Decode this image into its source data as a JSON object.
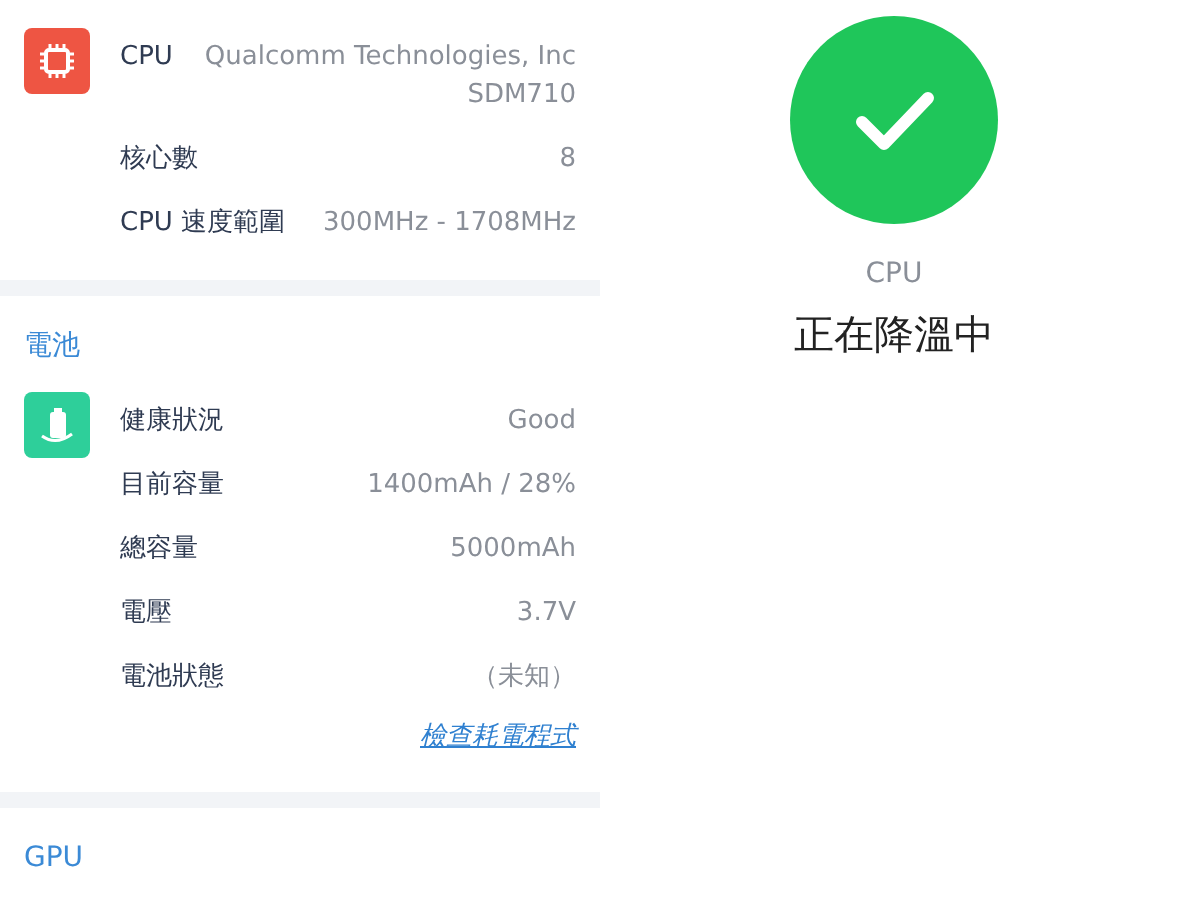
{
  "sections": [
    {
      "kind": "chip",
      "rows": [
        {
          "label": "CPU",
          "value": "Qualcomm Technologies, Inc\nSDM710"
        },
        {
          "label": "核心數",
          "value": "8"
        },
        {
          "label": "CPU 速度範圍",
          "value": "300MHz - 1708MHz"
        }
      ]
    },
    {
      "kind": "battery",
      "title": "電池",
      "rows": [
        {
          "label": "健康狀況",
          "value": "Good"
        },
        {
          "label": "目前容量",
          "value": "1400mAh / 28%"
        },
        {
          "label": "總容量",
          "value": "5000mAh"
        },
        {
          "label": "電壓",
          "value": "3.7V"
        },
        {
          "label": "電池狀態",
          "value": "（未知）"
        }
      ],
      "link": "檢查耗電程式"
    },
    {
      "title": "GPU"
    }
  ],
  "status": {
    "caption": "CPU",
    "text": "正在降溫中"
  }
}
